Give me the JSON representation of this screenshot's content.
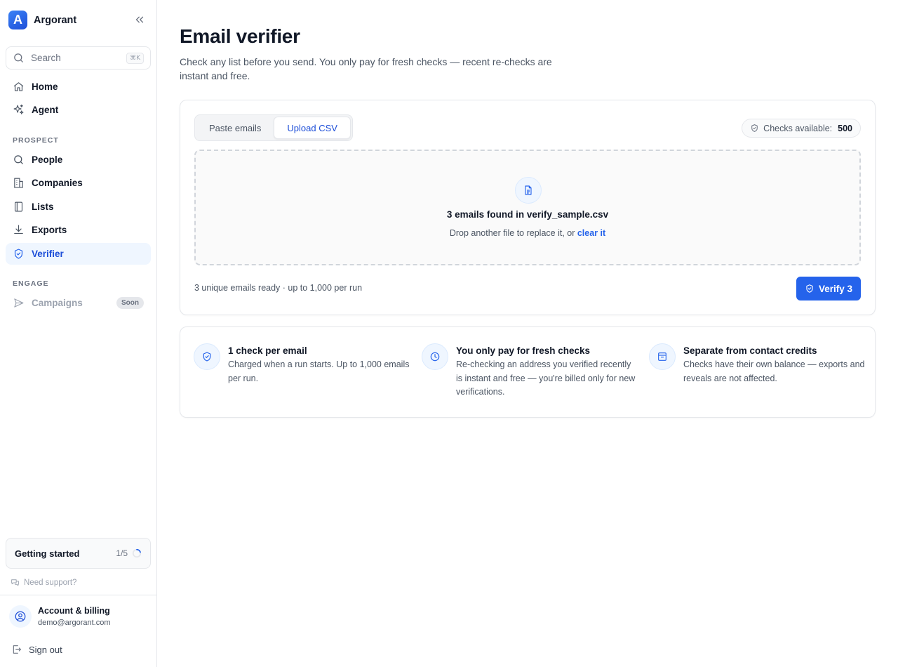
{
  "brand": {
    "name": "Argorant",
    "logo_letter": "A"
  },
  "search": {
    "label": "Search",
    "shortcut": "⌘K"
  },
  "nav": {
    "home": "Home",
    "agent": "Agent",
    "prospect_label": "PROSPECT",
    "people": "People",
    "companies": "Companies",
    "lists": "Lists",
    "exports": "Exports",
    "verifier": "Verifier",
    "engage_label": "ENGAGE",
    "campaigns": "Campaigns",
    "campaigns_badge": "Soon"
  },
  "getting_started": {
    "title": "Getting started",
    "progress": "1/5",
    "fraction": 0.2
  },
  "support": {
    "label": "Need support?"
  },
  "account": {
    "title": "Account & billing",
    "email": "demo@argorant.com",
    "sign_out": "Sign out"
  },
  "page": {
    "title": "Email verifier",
    "subtitle": "Check any list before you send. You only pay for fresh checks — recent re-checks are instant and free."
  },
  "tabs": {
    "paste": "Paste emails",
    "upload": "Upload CSV",
    "active": "Upload CSV"
  },
  "checks": {
    "label": "Checks available:",
    "value": "500"
  },
  "dropzone": {
    "title": "3 emails found in verify_sample.csv",
    "sub_prefix": "Drop another file to replace it, or ",
    "sub_link": "clear it"
  },
  "footer": {
    "ready_text": "3 unique emails ready · up to 1,000 per run",
    "verify_label": "Verify 3"
  },
  "features": [
    {
      "icon": "shield-check-icon",
      "title": "1 check per email",
      "desc": "Charged when a run starts. Up to 1,000 emails per run."
    },
    {
      "icon": "clock-icon",
      "title": "You only pay for fresh checks",
      "desc": "Re-checking an address you verified recently is instant and free — you're billed only for new verifications."
    },
    {
      "icon": "wallet-icon",
      "title": "Separate from contact credits",
      "desc": "Checks have their own balance — exports and reveals are not affected."
    }
  ],
  "colors": {
    "accent": "#2563eb",
    "accent_dark": "#1d4ed8",
    "active_bg": "#eff6ff",
    "border": "#e5e7eb"
  }
}
